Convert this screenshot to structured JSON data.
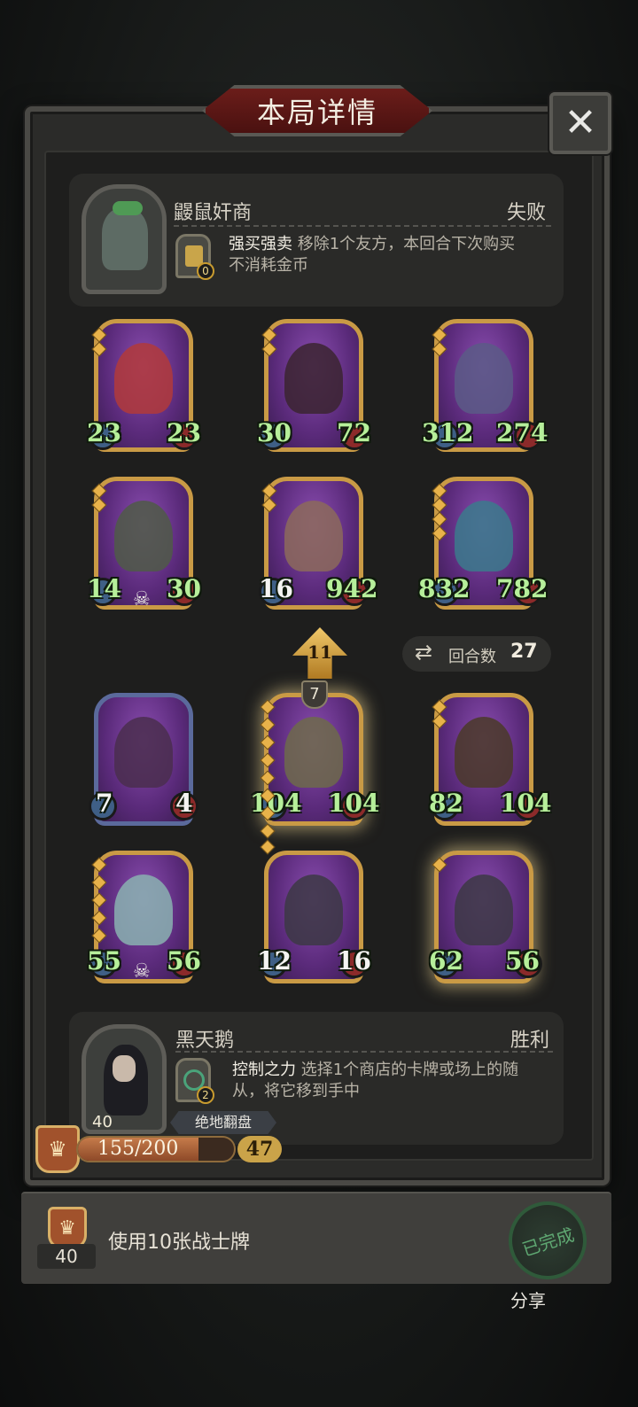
{
  "header": {
    "title": "本局详情",
    "close_icon": "close-icon"
  },
  "opponent": {
    "name": "鼹鼠奸商",
    "result": "失败",
    "skill_name": "强买强卖",
    "skill_desc_line1": "移除1个友方，本回合下次购买",
    "skill_desc_line2": "不消耗金币",
    "skill_badge": "0"
  },
  "round": {
    "label": "回合数",
    "value": "27"
  },
  "upgrade": {
    "arrow_value": "11",
    "tier": "7"
  },
  "cards": [
    {
      "atk": "23",
      "hp": "23"
    },
    {
      "atk": "30",
      "hp": "72"
    },
    {
      "atk": "312",
      "hp": "274"
    },
    {
      "atk": "14",
      "hp": "30"
    },
    {
      "atk": "16",
      "hp": "942"
    },
    {
      "atk": "832",
      "hp": "782"
    },
    {
      "atk": "7",
      "hp": "4"
    },
    {
      "atk": "104",
      "hp": "104"
    },
    {
      "atk": "82",
      "hp": "104"
    },
    {
      "atk": "55",
      "hp": "56"
    },
    {
      "atk": "12",
      "hp": "16"
    },
    {
      "atk": "62",
      "hp": "56"
    }
  ],
  "player": {
    "name": "黑天鹅",
    "result": "胜利",
    "skill_name": "控制之力",
    "skill_desc_line1": "选择1个商店的卡牌或场上的随",
    "skill_desc_line2": "从，将它移到手中",
    "skill_badge": "2",
    "title_tag": "绝地翻盘",
    "portrait_level": "40",
    "xp": "155/200",
    "xp_fraction": 0.775,
    "coins": "47"
  },
  "task": {
    "level": "40",
    "text": "使用10张战士牌",
    "stamp": "已完成",
    "share": "分享"
  }
}
